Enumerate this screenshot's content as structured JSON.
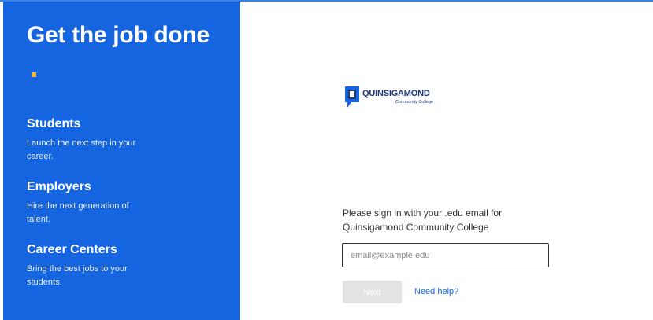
{
  "left_panel": {
    "headline": "Get the job done",
    "sections": [
      {
        "title": "Students",
        "desc_lines": [
          "Launch the next step in your",
          "career."
        ]
      },
      {
        "title": "Employers",
        "desc_lines": [
          "Hire the next generation of",
          "talent."
        ]
      },
      {
        "title": "Career Centers",
        "desc_lines": [
          "Bring the best jobs to your",
          "students."
        ]
      }
    ]
  },
  "logo": {
    "name": "QUINSIGAMOND",
    "subtitle": "Community College"
  },
  "signin": {
    "prompt_lines": [
      "Please sign in with your .edu email for",
      "Quinsigamond Community College"
    ],
    "email_placeholder": "email@example.edu",
    "next_label": "Next",
    "help_label": "Need help?"
  },
  "colors": {
    "panel_blue": "#1565e0",
    "accent_yellow": "#f5b942",
    "logo_navy": "#1e3a78",
    "link_blue": "#1565e0",
    "button_disabled": "#e3e3e3"
  }
}
